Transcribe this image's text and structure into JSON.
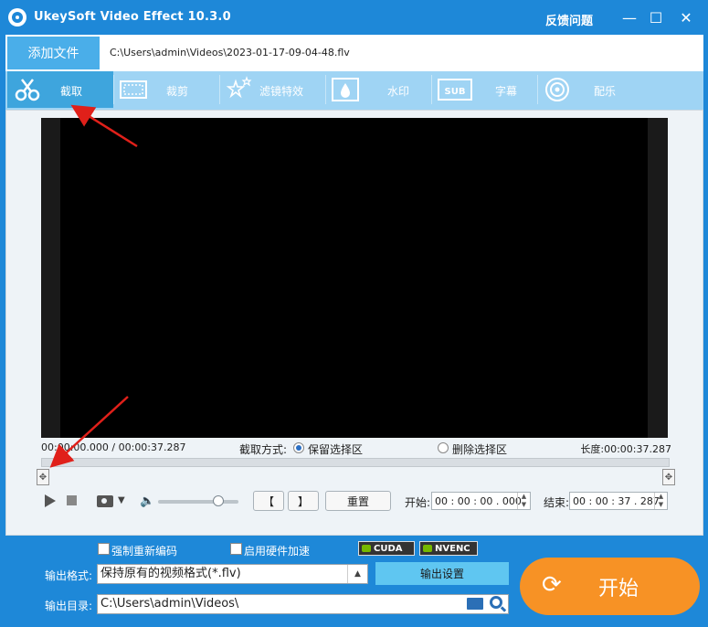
{
  "app": {
    "title": "UkeySoft Video Effect 10.3.0",
    "feedback": "反馈问题",
    "minimize": "—",
    "maximize": "☐",
    "close": "✕"
  },
  "file": {
    "add_label": "添加文件",
    "path": "C:\\Users\\admin\\Videos\\2023-01-17-09-04-48.flv"
  },
  "toolbar": {
    "tools": [
      {
        "label": "截取",
        "icon": "trim-icon",
        "active": true
      },
      {
        "label": "裁剪",
        "icon": "crop-icon",
        "active": false
      },
      {
        "label": "滤镜特效",
        "icon": "filter-icon",
        "active": false
      },
      {
        "label": "水印",
        "icon": "watermark-icon",
        "active": false
      },
      {
        "label": "字幕",
        "icon": "subtitle-icon",
        "active": false
      },
      {
        "label": "配乐",
        "icon": "music-icon",
        "active": false
      }
    ]
  },
  "player": {
    "current_time": "00:00:00.000",
    "separator": " / ",
    "total_time": "00:00:37.287",
    "mode_label": "截取方式:",
    "mode_keep": "保留选择区",
    "mode_delete": "删除选择区",
    "length_label": "长度:",
    "length_value": "00:00:37.287",
    "volume_level": 0.75
  },
  "controls": {
    "bracket_left": "【",
    "bracket_right": "】",
    "reset_label": "重置",
    "start_label": "开始:",
    "start_value": "00 : 00 : 00 . 000",
    "end_label": "结束:",
    "end_value": "00 : 00 : 37 . 287"
  },
  "options": {
    "force_reencode": "强制重新编码",
    "hw_accel": "启用硬件加速",
    "cuda": "CUDA",
    "nvenc": "NVENC"
  },
  "output": {
    "format_label": "输出格式:",
    "format_value": "保持原有的视频格式(*.flv)",
    "settings_label": "输出设置",
    "dir_label": "输出目录:",
    "dir_value": "C:\\Users\\admin\\Videos\\",
    "start_button": "开始"
  },
  "colors": {
    "titlebar": "#1e88d8",
    "toolbar": "#9fd4f4",
    "active_tool": "#3ea5dd",
    "start_button": "#f79225",
    "arrow": "#e0201a"
  }
}
